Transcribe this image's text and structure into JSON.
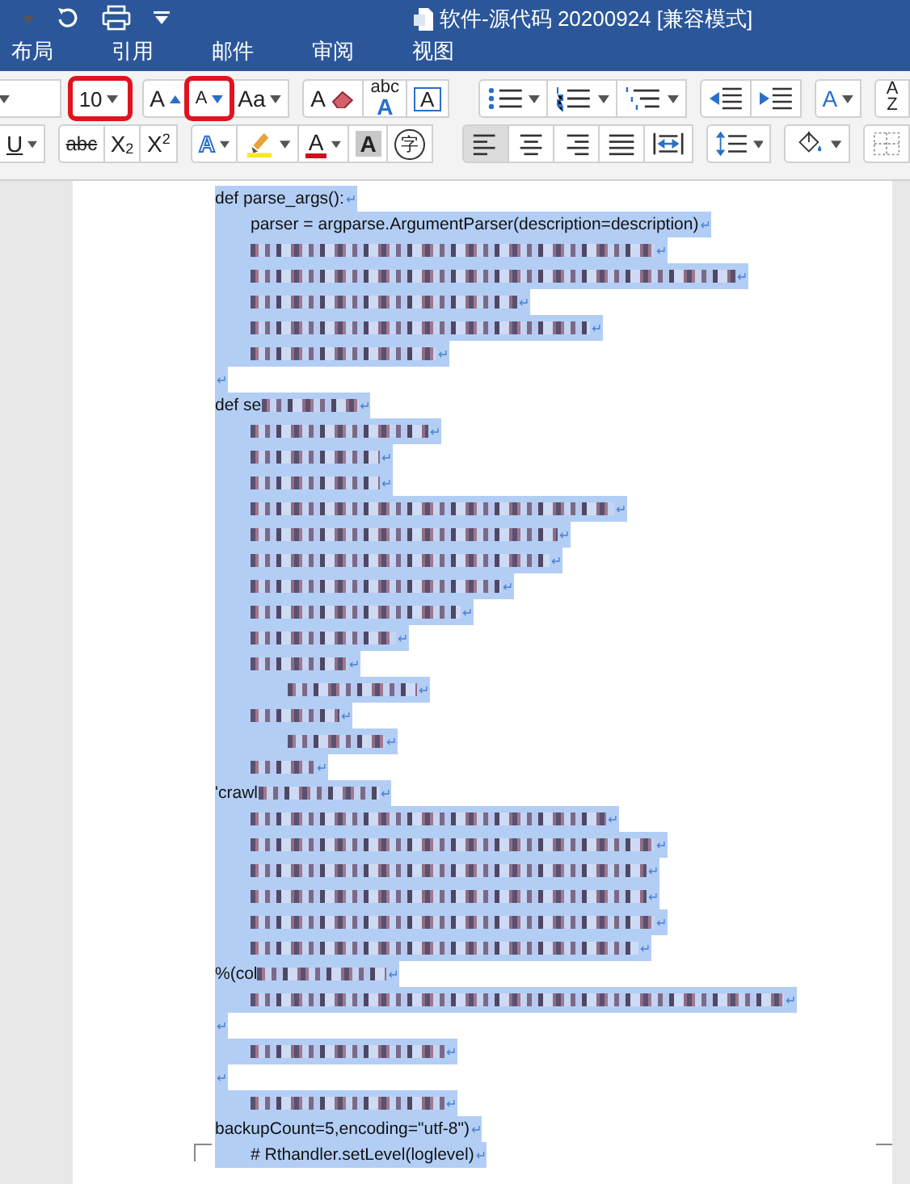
{
  "window": {
    "title": "软件-源代码 20200924 [兼容模式]"
  },
  "tabs": [
    {
      "label": "布局",
      "selected": false
    },
    {
      "label": "引用",
      "selected": false
    },
    {
      "label": "邮件",
      "selected": false
    },
    {
      "label": "审阅",
      "selected": false
    },
    {
      "label": "视图",
      "selected": false
    }
  ],
  "ribbon": {
    "row_1": [
      {
        "kind": "font-name",
        "dropdown": true,
        "highlighted": false
      },
      {
        "kind": "font-size",
        "value": "10",
        "dropdown": true,
        "highlighted": true
      },
      {
        "kind": "grow",
        "label": "A",
        "highlighted": false
      },
      {
        "kind": "shrink",
        "label": "A",
        "highlighted": true
      },
      {
        "kind": "case",
        "label": "Aa",
        "dropdown": true,
        "highlighted": false
      },
      {
        "kind": "eraser",
        "label": "A",
        "highlighted": false
      },
      {
        "kind": "phonetic",
        "label": "abc",
        "label_2": "A",
        "highlighted": false
      },
      {
        "kind": "boxed",
        "label": "A",
        "highlighted": false
      },
      {
        "kind": "bullets",
        "dropdown": true,
        "highlighted": false
      },
      {
        "kind": "numbering",
        "dropdown": true,
        "highlighted": false
      },
      {
        "kind": "multilevel",
        "dropdown": true,
        "highlighted": false
      },
      {
        "kind": "outdent",
        "highlighted": false
      },
      {
        "kind": "indent",
        "highlighted": false
      },
      {
        "kind": "direction",
        "label": "A",
        "dropdown": true,
        "highlighted": false
      },
      {
        "kind": "sort",
        "label": "A",
        "label_2": "Z",
        "highlighted": false
      }
    ],
    "row_2": [
      {
        "kind": "underline",
        "label": "U",
        "dropdown": true,
        "selected": false
      },
      {
        "kind": "strike",
        "label": "abc",
        "selected": false
      },
      {
        "kind": "subscript",
        "label": "X",
        "label_2": "2",
        "selected": false
      },
      {
        "kind": "superscript",
        "label": "X",
        "label_2": "2",
        "selected": false
      },
      {
        "kind": "effects",
        "label": "A",
        "dropdown": true,
        "selected": false
      },
      {
        "kind": "highlighter",
        "dropdown": true,
        "selected": false
      },
      {
        "kind": "font-color",
        "label": "A",
        "dropdown": true,
        "selected": false
      },
      {
        "kind": "shaded",
        "label": "A",
        "selected": false
      },
      {
        "kind": "enclosed",
        "label": "字",
        "selected": false
      },
      {
        "kind": "align-left",
        "selected": true
      },
      {
        "kind": "align-center",
        "selected": false
      },
      {
        "kind": "align-right",
        "selected": false
      },
      {
        "kind": "justify",
        "selected": false
      },
      {
        "kind": "distribute",
        "selected": false
      },
      {
        "kind": "line-spacing",
        "dropdown": true,
        "selected": false
      },
      {
        "kind": "shading",
        "dropdown": true,
        "selected": false
      },
      {
        "kind": "borders",
        "selected": false
      }
    ]
  },
  "document": {
    "lines": [
      {
        "kind": "top",
        "text": "def parse_args():",
        "blurred": false,
        "end_mark": "↵"
      },
      {
        "kind": "body",
        "text": "parser = argparse.ArgumentParser(description=description)",
        "blurred": false,
        "end_mark": "↵"
      },
      {
        "kind": "body",
        "blurred": true,
        "end_mark": "↵"
      },
      {
        "kind": "body",
        "blurred": true,
        "end_mark": "↵"
      },
      {
        "kind": "body",
        "blurred": true,
        "end_mark": "↵"
      },
      {
        "kind": "body",
        "blurred": true,
        "end_mark": "↵"
      },
      {
        "kind": "body",
        "blurred": true,
        "end_mark": "↵"
      },
      {
        "kind": "top",
        "blurred": false,
        "end_mark": "↵"
      },
      {
        "kind": "top",
        "text": "def se",
        "blurred": true,
        "end_mark": "↵"
      },
      {
        "kind": "body",
        "blurred": true,
        "end_mark": "↵"
      },
      {
        "kind": "body",
        "blurred": true,
        "end_mark": "↵"
      },
      {
        "kind": "body",
        "blurred": true,
        "end_mark": "↵"
      },
      {
        "kind": "body",
        "blurred": true,
        "end_mark": "↵"
      },
      {
        "kind": "body",
        "blurred": true,
        "end_mark": "↵"
      },
      {
        "kind": "body",
        "blurred": true,
        "end_mark": "↵"
      },
      {
        "kind": "body",
        "blurred": true,
        "end_mark": "↵"
      },
      {
        "kind": "body",
        "blurred": true,
        "end_mark": "↵"
      },
      {
        "kind": "body",
        "blurred": true,
        "end_mark": "↵"
      },
      {
        "kind": "body",
        "blurred": true,
        "end_mark": "↵"
      },
      {
        "kind": "nested",
        "blurred": true,
        "end_mark": "↵"
      },
      {
        "kind": "body",
        "blurred": true,
        "end_mark": "↵"
      },
      {
        "kind": "nested",
        "blurred": true,
        "end_mark": "↵"
      },
      {
        "kind": "body",
        "blurred": true,
        "end_mark": "↵"
      },
      {
        "kind": "top",
        "text": "'crawl",
        "blurred": true,
        "end_mark": "↵"
      },
      {
        "kind": "body",
        "blurred": true,
        "end_mark": "↵"
      },
      {
        "kind": "body",
        "blurred": true,
        "end_mark": "↵"
      },
      {
        "kind": "body",
        "blurred": true,
        "end_mark": "↵"
      },
      {
        "kind": "body",
        "blurred": true,
        "end_mark": "↵"
      },
      {
        "kind": "body",
        "blurred": true,
        "end_mark": "↵"
      },
      {
        "kind": "body",
        "blurred": true,
        "end_mark": "↵"
      },
      {
        "kind": "top",
        "text": "%(col",
        "blurred": true,
        "end_mark": "↵"
      },
      {
        "kind": "body",
        "blurred": true,
        "end_mark": "↵"
      },
      {
        "kind": "top",
        "blurred": false,
        "end_mark": "↵"
      },
      {
        "kind": "body",
        "blurred": true,
        "end_mark": "↵"
      },
      {
        "kind": "top",
        "blurred": false,
        "end_mark": "↵"
      },
      {
        "kind": "body",
        "blurred": true,
        "end_mark": "↵"
      },
      {
        "kind": "top",
        "text": "backupCount=5,encoding=\"utf-8\")",
        "blurred": false,
        "end_mark": "↵"
      },
      {
        "kind": "body",
        "text": "# Rthandler.setLevel(loglevel)",
        "blurred": false,
        "end_mark": "↵"
      }
    ]
  }
}
